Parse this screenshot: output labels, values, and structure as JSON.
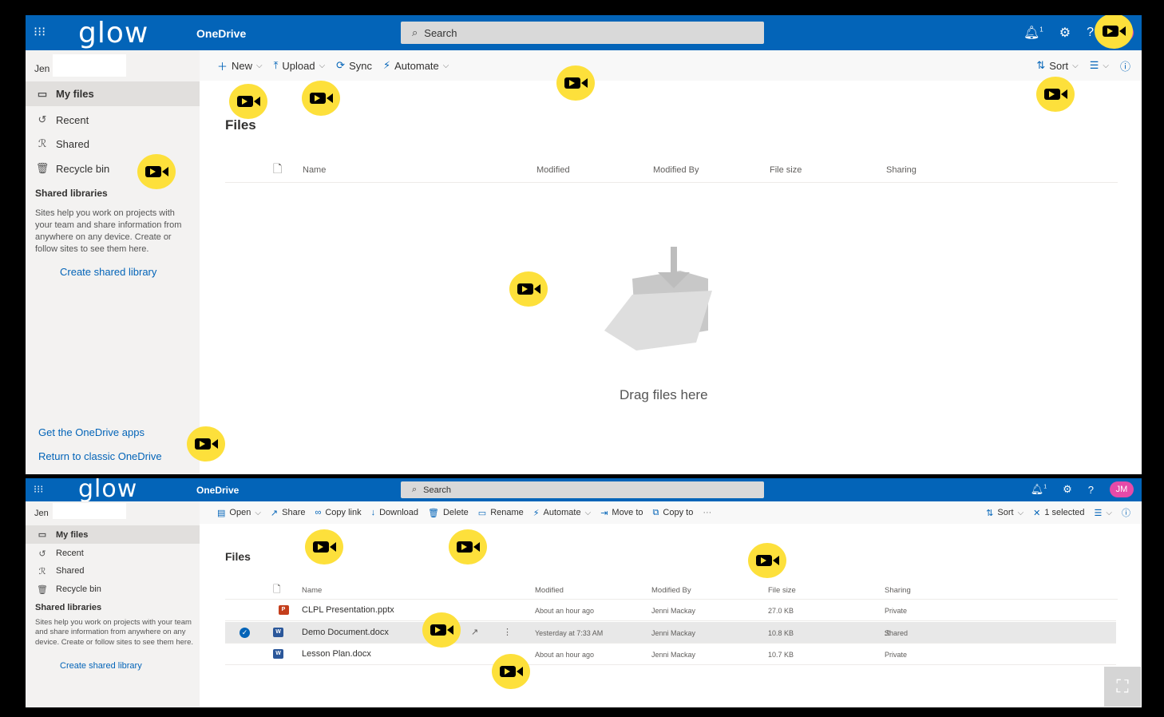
{
  "suite": {
    "logo": "glow",
    "app_name": "OneDrive",
    "search_placeholder": "Search",
    "avatar_initials": "JM",
    "notification_count": "1"
  },
  "nav": {
    "user": "Jen",
    "items": [
      {
        "label": "My files"
      },
      {
        "label": "Recent"
      },
      {
        "label": "Shared"
      },
      {
        "label": "Recycle bin"
      }
    ],
    "shared_libraries_heading": "Shared libraries",
    "shared_libraries_text": "Sites help you work on projects with your team and share information from anywhere on any device. Create or follow sites to see them here.",
    "create_shared_library": "Create shared library",
    "get_apps": "Get the OneDrive apps",
    "return_classic": "Return to classic OneDrive"
  },
  "top_commands": {
    "new": "New",
    "upload": "Upload",
    "sync": "Sync",
    "automate": "Automate",
    "sort": "Sort"
  },
  "bottom_commands": {
    "open": "Open",
    "share": "Share",
    "copy_link": "Copy link",
    "download": "Download",
    "delete": "Delete",
    "rename": "Rename",
    "automate": "Automate",
    "move_to": "Move to",
    "copy_to": "Copy to",
    "more": "···",
    "sort": "Sort",
    "selected": "1 selected"
  },
  "page_title": "Files",
  "columns": {
    "name": "Name",
    "modified": "Modified",
    "modified_by": "Modified By",
    "file_size": "File size",
    "sharing": "Sharing"
  },
  "empty_state": "Drag files here",
  "files": [
    {
      "name": "CLPL Presentation.pptx",
      "type": "pptx",
      "modified": "About an hour ago",
      "modified_by": "Jenni Mackay",
      "size": "27.0 KB",
      "sharing": "Private"
    },
    {
      "name": "Demo Document.docx",
      "type": "docx",
      "modified": "Yesterday at 7:33 AM",
      "modified_by": "Jenni Mackay",
      "size": "10.8 KB",
      "sharing": "Shared",
      "selected": true
    },
    {
      "name": "Lesson Plan.docx",
      "type": "docx",
      "modified": "About an hour ago",
      "modified_by": "Jenni Mackay",
      "size": "10.7 KB",
      "sharing": "Private"
    }
  ],
  "colors": {
    "suite_bar": "#0364b8",
    "nav_bg": "#f3f2f1",
    "video_marker": "#fde03b",
    "pptx_icon": "#c43e1c",
    "docx_icon": "#2b579a"
  }
}
